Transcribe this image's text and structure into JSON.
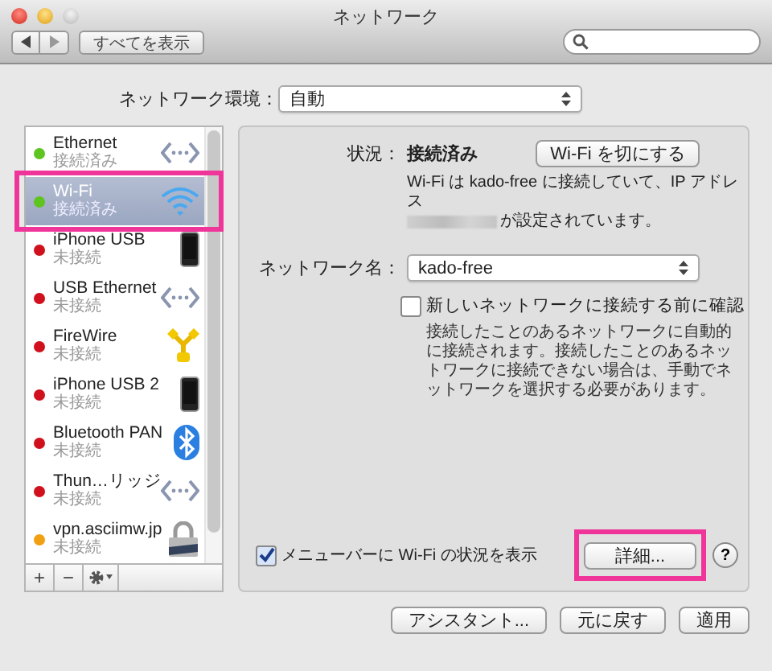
{
  "window": {
    "title": "ネットワーク"
  },
  "toolbar": {
    "show_all_button": "すべてを表示"
  },
  "location": {
    "label": "ネットワーク環境：",
    "value": "自動"
  },
  "services": [
    {
      "name": "Ethernet",
      "status": "接続済み",
      "color": "#5ec41f",
      "selected": false,
      "kind": "ethernet"
    },
    {
      "name": "Wi-Fi",
      "status": "接続済み",
      "color": "#5ec41f",
      "selected": true,
      "kind": "wifi"
    },
    {
      "name": "iPhone USB",
      "status": "未接続",
      "color": "#d0101c",
      "selected": false,
      "kind": "phone"
    },
    {
      "name": "USB Ethernet",
      "status": "未接続",
      "color": "#d0101c",
      "selected": false,
      "kind": "ethernet"
    },
    {
      "name": "FireWire",
      "status": "未接続",
      "color": "#d0101c",
      "selected": false,
      "kind": "firewire"
    },
    {
      "name": "iPhone USB 2",
      "status": "未接続",
      "color": "#d0101c",
      "selected": false,
      "kind": "phone"
    },
    {
      "name": "Bluetooth PAN",
      "status": "未接続",
      "color": "#d0101c",
      "selected": false,
      "kind": "bluetooth"
    },
    {
      "name": "Thun…リッジ",
      "status": "未接続",
      "color": "#d0101c",
      "selected": false,
      "kind": "ethernet"
    },
    {
      "name": "vpn.asciimw.jp",
      "status": "未接続",
      "color": "#f0a010",
      "selected": false,
      "kind": "vpn"
    }
  ],
  "sidebar_buttons": [
    "+",
    "−"
  ],
  "detail": {
    "status_label": "状況：",
    "status_value": "接続済み",
    "toggle_button": "Wi-Fi を切にする",
    "status_description": [
      "Wi-Fi は kado-free に接続していて、IP アドレス",
      "が設定されています。"
    ],
    "network_name_label": "ネットワーク名：",
    "network_name": "kado-free",
    "ask_to_join": {
      "label": "新しいネットワークに接続する前に確認",
      "checked": false
    },
    "ask_to_join_note": "接続したことのあるネットワークに自動的に接続されます。接続したことのあるネットワークに接続できない場合は、手動でネットワークを選択する必要があります。",
    "show_in_menu_bar": {
      "label": "メニューバーに Wi-Fi の状況を表示",
      "checked": true
    },
    "advanced_button": "詳細...",
    "help_button": "?"
  },
  "buttons": [
    "アシスタント...",
    "元に戻す",
    "適用"
  ]
}
